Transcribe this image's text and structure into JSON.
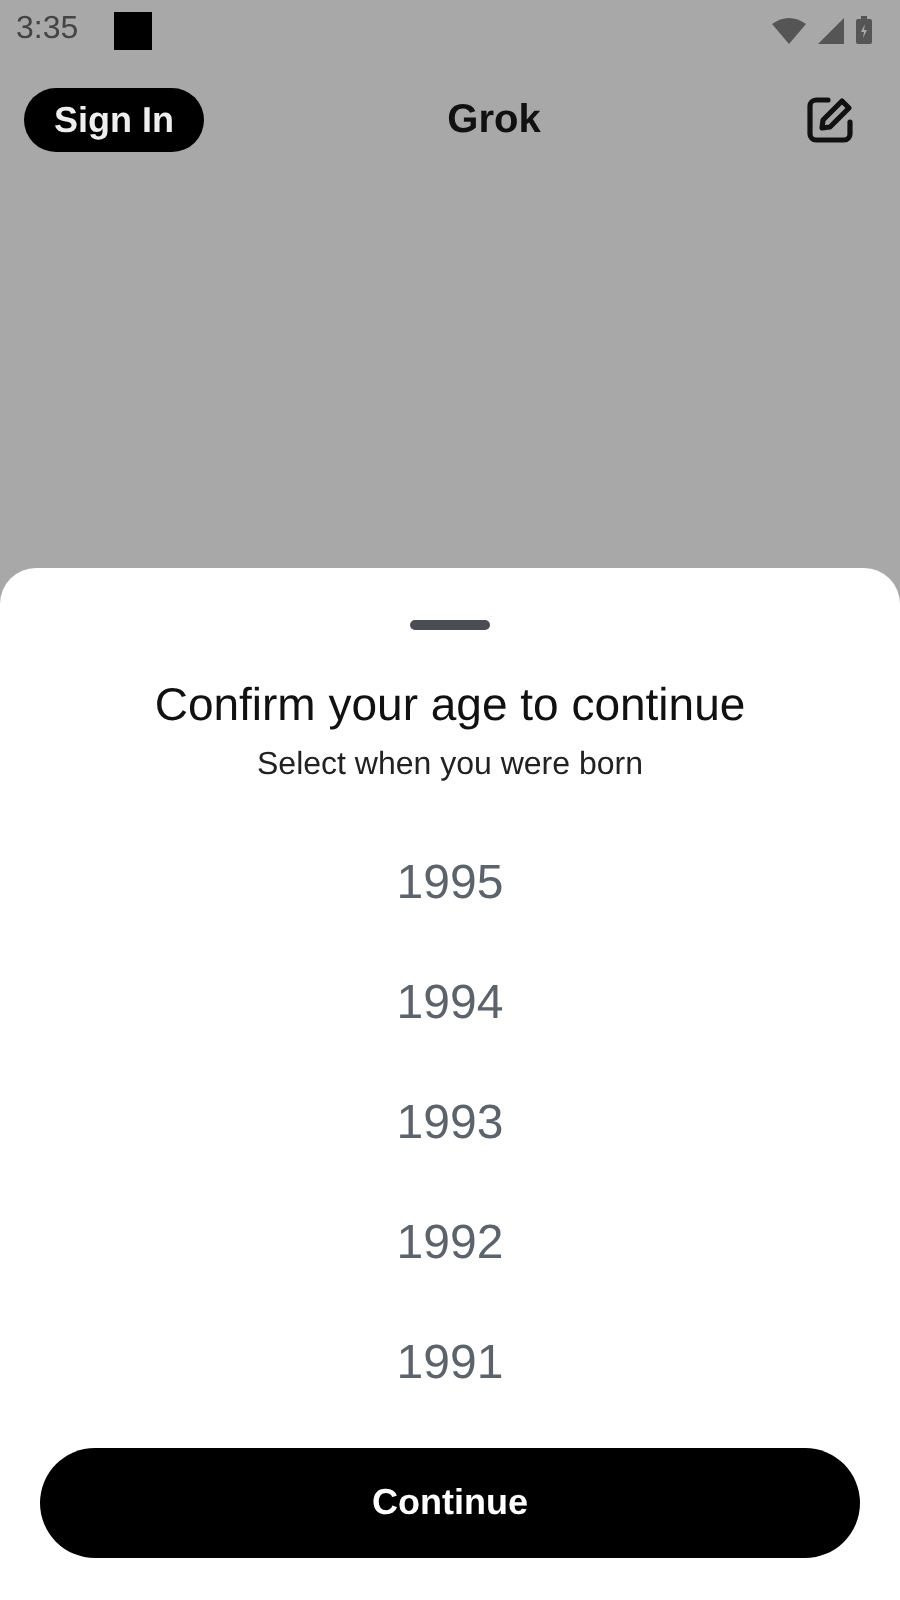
{
  "status_bar": {
    "time": "3:35"
  },
  "header": {
    "sign_in": "Sign In",
    "title": "Grok"
  },
  "sheet": {
    "title": "Confirm your age to continue",
    "subtitle": "Select when you were born",
    "years": [
      "1995",
      "1994",
      "1993",
      "1992",
      "1991"
    ],
    "button": "Continue"
  }
}
